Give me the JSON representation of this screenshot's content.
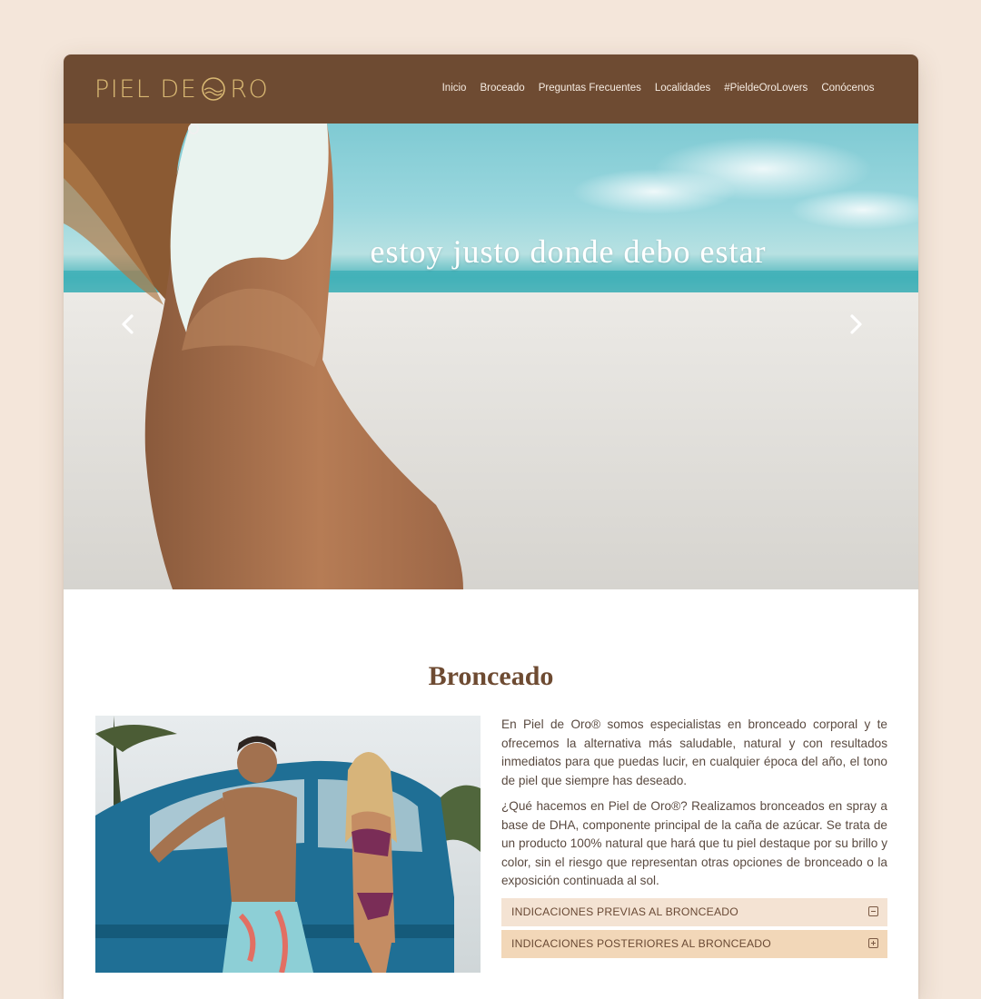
{
  "brand": {
    "logo_text_left": "PIEL DE ",
    "logo_text_right": "RO",
    "logo_color": "#d9b873",
    "header_color": "#6e4b32"
  },
  "nav": {
    "items": [
      {
        "label": "Inicio"
      },
      {
        "label": "Broceado"
      },
      {
        "label": "Preguntas Frecuentes"
      },
      {
        "label": "Localidades"
      },
      {
        "label": "#PieldeOroLovers"
      },
      {
        "label": "Conócenos"
      }
    ]
  },
  "hero": {
    "caption": "estoy justo donde debo estar",
    "prev_icon": "chevron-left-icon",
    "next_icon": "chevron-right-icon",
    "slides_total": 3,
    "active_slide": 2
  },
  "section": {
    "title": "Bronceado",
    "paragraphs": [
      "En Piel de Oro® somos especialistas en bronceado corporal y te ofrecemos la alternativa más saludable, natural y con resultados inmediatos para que puedas lucir, en cualquier época del año, el tono de piel que siempre has deseado.",
      "¿Qué hacemos en Piel de Oro®? Realizamos bronceados en spray a base de DHA, componente principal de la caña de azúcar. Se trata de un producto 100% natural que hará que tu piel destaque por su brillo y color, sin el riesgo que representan otras opciones de bronceado o la exposición continuada al sol."
    ],
    "accordion": [
      {
        "label": "INDICACIONES PREVIAS AL BRONCEADO",
        "icon": "minus-square-icon",
        "expanded": true
      },
      {
        "label": "INDICACIONES POSTERIORES AL BRONCEADO",
        "icon": "plus-square-icon",
        "expanded": false
      }
    ]
  },
  "colors": {
    "page_bg": "#f4e6da",
    "accent_brown": "#6e4b32",
    "accordion_open": "#f4e3d3",
    "accordion_closed": "#f2d7b8"
  }
}
